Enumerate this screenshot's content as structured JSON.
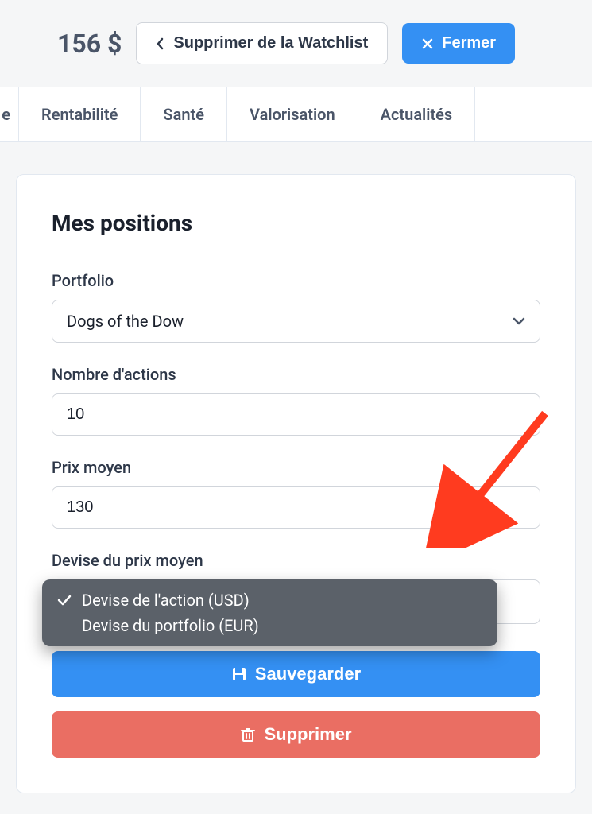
{
  "header": {
    "price": "156 $",
    "remove_watchlist_label": "Supprimer de la Watchlist",
    "close_label": "Fermer"
  },
  "tabs": {
    "items": [
      {
        "label": "Rentabilité"
      },
      {
        "label": "Santé"
      },
      {
        "label": "Valorisation"
      },
      {
        "label": "Actualités"
      }
    ]
  },
  "panel": {
    "title": "Mes positions",
    "portfolio": {
      "label": "Portfolio",
      "value": "Dogs of the Dow"
    },
    "shares": {
      "label": "Nombre d'actions",
      "value": "10"
    },
    "avg_price": {
      "label": "Prix moyen",
      "value": "130"
    },
    "currency": {
      "label": "Devise du prix moyen",
      "options": [
        {
          "label": "Devise de l'action (USD)",
          "selected": true
        },
        {
          "label": "Devise du portfolio (EUR)",
          "selected": false
        }
      ]
    },
    "save_label": "Sauvegarder",
    "delete_label": "Supprimer"
  },
  "colors": {
    "primary": "#3490f3",
    "danger": "#ea6e63",
    "dropdown": "#5b6169",
    "arrow": "#ff3b1f"
  }
}
